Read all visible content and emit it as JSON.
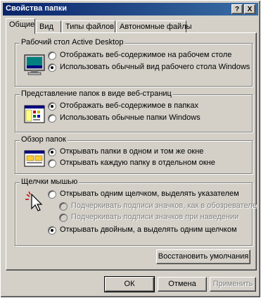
{
  "window": {
    "title": "Свойства папки",
    "help_label": "?",
    "close_label": "X"
  },
  "tabs": [
    {
      "label": "Общие",
      "active": true
    },
    {
      "label": "Вид",
      "active": false
    },
    {
      "label": "Типы файлов",
      "active": false
    },
    {
      "label": "Автономные файлы",
      "active": false
    }
  ],
  "groups": {
    "active_desktop": {
      "title": "Рабочий стол Active Desktop",
      "icon": "desktop-monitor-icon",
      "options": [
        {
          "label": "Отображать веб-содержимое на рабочем столе",
          "checked": false,
          "disabled": false
        },
        {
          "label": "Использовать обычный вид рабочего стола Windows",
          "checked": true,
          "disabled": false
        }
      ]
    },
    "web_view": {
      "title": "Представление папок в виде веб-страниц",
      "icon": "folder-web-view-icon",
      "options": [
        {
          "label": "Отображать веб-содержимое в папках",
          "checked": true,
          "disabled": false
        },
        {
          "label": "Использовать обычные папки Windows",
          "checked": false,
          "disabled": false
        }
      ]
    },
    "browse": {
      "title": "Обзор папок",
      "icon": "browse-folders-icon",
      "options": [
        {
          "label": "Открывать папки в одном и том же окне",
          "checked": true,
          "disabled": false
        },
        {
          "label": "Открывать каждую папку в отдельном окне",
          "checked": false,
          "disabled": false
        }
      ]
    },
    "click": {
      "title": "Щелчки мышью",
      "icon": "mouse-click-cursor-icon",
      "options": [
        {
          "label": "Открывать одним щелчком, выделять указателем",
          "checked": false,
          "disabled": false
        },
        {
          "label": "Подчеркивать подписи значков, как в обозревателе",
          "checked": false,
          "disabled": true
        },
        {
          "label": "Подчеркивать подписи значков при наведении",
          "checked": false,
          "disabled": true
        },
        {
          "label": "Открывать двойным, а выделять одним щелчком",
          "checked": true,
          "disabled": false
        }
      ]
    }
  },
  "buttons": {
    "restore_defaults": "Восстановить умолчания",
    "ok": "ОК",
    "cancel": "Отмена",
    "apply": "Применить"
  }
}
